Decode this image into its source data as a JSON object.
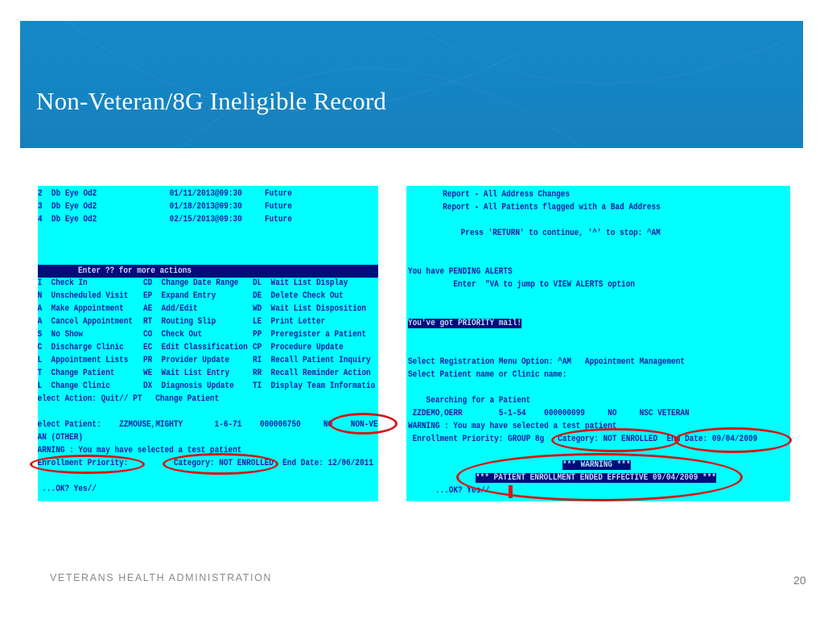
{
  "slide": {
    "title": "Non-Veteran/8G Ineligible Record",
    "footer": "VETERANS HEALTH ADMINISTRATION",
    "page_number": "20",
    "colors": {
      "banner": "#1688c6",
      "terminal_bg": "#00ffff",
      "terminal_text": "#1a1aa0",
      "highlight_bg": "#000c7a",
      "annotation": "#d81515"
    }
  },
  "left_terminal": {
    "appointments": [
      {
        "num": "2",
        "clinic": "Db Eye Od2",
        "datetime": "01/11/2013@09:30",
        "status": "Future"
      },
      {
        "num": "3",
        "clinic": "Db Eye Od2",
        "datetime": "01/18/2013@09:30",
        "status": "Future"
      },
      {
        "num": "4",
        "clinic": "Db Eye Od2",
        "datetime": "02/15/2013@09:30",
        "status": "Future"
      }
    ],
    "actions_bar": "Enter ?? for more actions",
    "actions": [
      [
        "CI  Check In",
        "CD  Change Date Range",
        "DL  Wait List Display"
      ],
      [
        "UN  Unscheduled Visit",
        "EP  Expand Entry",
        "DE  Delete Check Out"
      ],
      [
        "MA  Make Appointment",
        "AE  Add/Edit",
        "WD  Wait List Disposition"
      ],
      [
        "CA  Cancel Appointment",
        "RT  Routing Slip",
        "LE  Print Letter"
      ],
      [
        "NS  No Show",
        "CO  Check Out",
        "PP  Preregister a Patient"
      ],
      [
        "DC  Discharge Clinic",
        "EC  Edit Classification",
        "CP  Procedure Update"
      ],
      [
        "AL  Appointment Lists",
        "PR  Provider Update",
        "RI  Recall Patient Inquiry"
      ],
      [
        "PT  Change Patient",
        "WE  Wait List Entry",
        "RR  Recall Reminder Action"
      ],
      [
        "CL  Change Clinic",
        "DX  Diagnosis Update",
        "TI  Display Team Informatio"
      ]
    ],
    "select_action": "Select Action: Quit// PT   Change Patient",
    "select_patient": "Select Patient:    ZZMOUSE,MIGHTY       1-6-71    000006750     NO    NON-VETE",
    "patient_cont": "RAN (OTHER)",
    "warning": "WARNING : You may have selected a test patient",
    "enrollment_line": " Enrollment Priority:          Category: NOT ENROLLED  End Date: 12/06/2011",
    "ok_prompt": "  ...OK? Yes//"
  },
  "right_terminal": {
    "report1": "        Report - All Address Changes",
    "report2": "        Report - All Patients flagged with a Bad Address",
    "press_return": "            Press 'RETURN' to continue, '^' to stop: ^AM",
    "pending_alerts": "You have PENDING ALERTS",
    "view_alerts": "          Enter  \"VA to jump to VIEW ALERTS option",
    "priority_mail": "You've got PRIORITY mail!",
    "registration_menu": "Select Registration Menu Option: ^AM   Appointment Management",
    "select_patient": "Select Patient name or Clinic name:",
    "searching": "    Searching for a Patient",
    "patient_row": " ZZDEMO,OERR        5-1-54    000000099     NO     NSC VETERAN",
    "warning": "WARNING : You may have selected a test patient",
    "enrollment_line": " Enrollment Priority: GROUP 8g   Category: NOT ENROLLED  End Date: 09/04/2009",
    "warning_header": "*** WARNING ***",
    "enrollment_ended": "*** PATIENT ENROLLMENT ENDED EFFECTIVE 09/04/2009 ***",
    "ok_prompt": "      ...OK? Yes//"
  }
}
